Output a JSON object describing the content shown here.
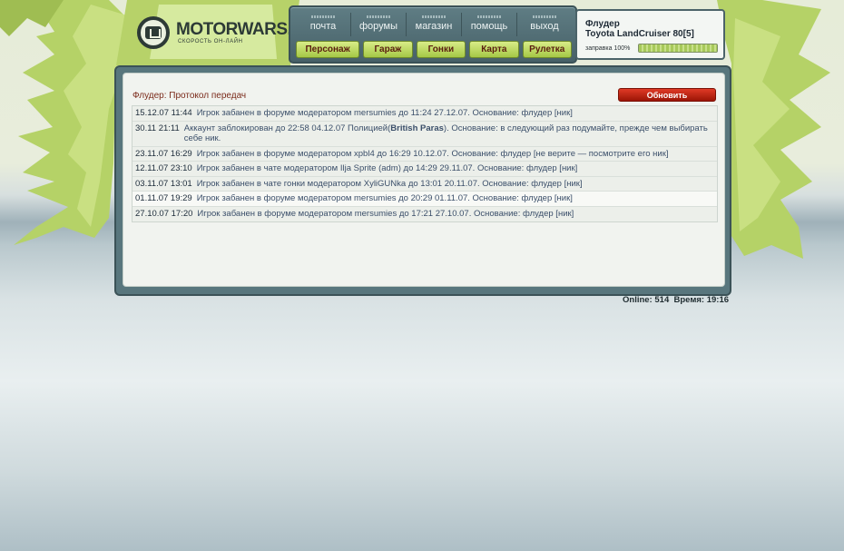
{
  "brand": {
    "name": "MOTORWARS.RU",
    "tagline": "СКОРОСТЬ ОН-ЛАЙН"
  },
  "nav": {
    "links": [
      "почта",
      "форумы",
      "магазин",
      "помощь",
      "выход"
    ],
    "buttons": [
      "Персонаж",
      "Гараж",
      "Гонки",
      "Карта",
      "Рулетка"
    ]
  },
  "user": {
    "name": "Флудер",
    "car": "Toyota LandCruiser 80[5]",
    "fuel_label": "заправка 100%",
    "fuel_percent": 100
  },
  "panel": {
    "title": "Флудер: Протокол передач",
    "refresh_label": "Обновить"
  },
  "log": [
    {
      "time": "15.12.07 11:44",
      "text": "Игрок забанен в форуме модератором mersumies до 11:24 27.12.07. Основание: флудер [ник]"
    },
    {
      "time": "30.11 21:11",
      "text_before": "Аккаунт заблокирован до 22:58 04.12.07 Полицией(",
      "text_bold": "British Paras",
      "text_after": "). Основание: в следующий раз подумайте, прежде чем выбирать себе ник."
    },
    {
      "time": "23.11.07 16:29",
      "text": "Игрок забанен в форуме модератором xpbl4 до 16:29 10.12.07. Основание: флудер [не верите — посмотрите его ник]"
    },
    {
      "time": "12.11.07 23:10",
      "text": "Игрок забанен в чате модератором Ilja Sprite (adm) до 14:29 29.11.07. Основание: флудер [ник]"
    },
    {
      "time": "03.11.07 13:01",
      "text": "Игрок забанен в чате гонки модератором XyliGUNka до 13:01 20.11.07. Основание: флудер [ник]"
    },
    {
      "time": "01.11.07 19:29",
      "text": "Игрок забанен в форуме модератором mersumies до 20:29 01.11.07. Основание: флудер [ник]"
    },
    {
      "time": "27.10.07 17:20",
      "text": "Игрок забанен в форуме модератором mersumies до 17:21 27.10.07. Основание: флудер [ник]"
    }
  ],
  "status": {
    "online_label": "Online:",
    "online_count": "514",
    "time_label": "Время:",
    "time": "19:16"
  },
  "colors": {
    "accent_green": "#a5c846",
    "frame": "#58767d",
    "refresh_red": "#c0260f",
    "title_red": "#7a2a1a"
  }
}
